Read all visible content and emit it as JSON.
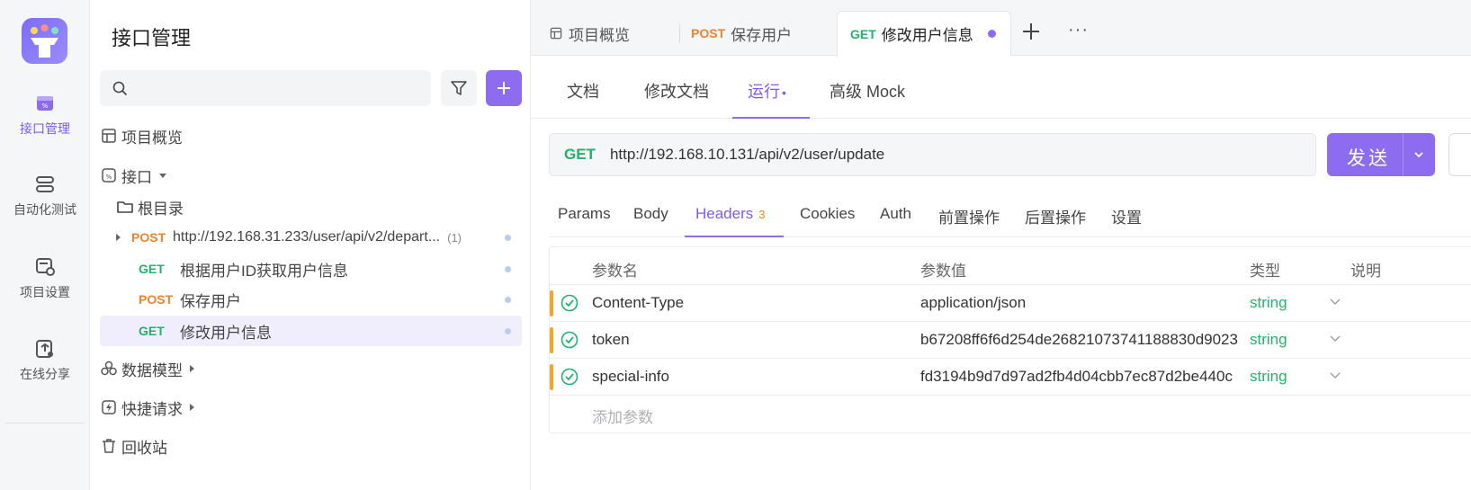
{
  "rail": {
    "items": [
      {
        "label": "接口管理",
        "icon": "api-management-icon",
        "active": true
      },
      {
        "label": "自动化测试",
        "icon": "automation-test-icon",
        "active": false
      },
      {
        "label": "项目设置",
        "icon": "project-settings-icon",
        "active": false
      },
      {
        "label": "在线分享",
        "icon": "online-share-icon",
        "active": false
      }
    ]
  },
  "tree": {
    "title": "接口管理",
    "search_placeholder": "",
    "overview": "项目概览",
    "api_group": "接口",
    "root_dir": "根目录",
    "endpoints": [
      {
        "method": "POST",
        "name": "http://192.168.31.233/user/api/v2/depart...",
        "count": "(1)"
      },
      {
        "method": "GET",
        "name": "根据用户ID获取用户信息"
      },
      {
        "method": "POST",
        "name": "保存用户"
      },
      {
        "method": "GET",
        "name": "修改用户信息"
      }
    ],
    "data_model": "数据模型",
    "quick_request": "快捷请求",
    "recycle_bin": "回收站"
  },
  "tabs": {
    "items": [
      {
        "method": "",
        "label": "项目概览"
      },
      {
        "method": "POST",
        "label": "保存用户"
      },
      {
        "method": "GET",
        "label": "修改用户信息"
      }
    ]
  },
  "subtabs": {
    "items": [
      "文档",
      "修改文档",
      "运行",
      "高级 Mock"
    ],
    "run_dot": "•"
  },
  "request": {
    "method": "GET",
    "url": "http://192.168.10.131/api/v2/user/update",
    "send_label": "发送"
  },
  "param_tabs": {
    "items": [
      "Params",
      "Body",
      "Headers",
      "Cookies",
      "Auth",
      "前置操作",
      "后置操作",
      "设置"
    ],
    "headers_count": "3"
  },
  "headers_table": {
    "columns": [
      "参数名",
      "参数值",
      "类型",
      "说明"
    ],
    "rows": [
      {
        "name": "Content-Type",
        "value": "application/json",
        "type": "string"
      },
      {
        "name": "token",
        "value": "b67208ff6f6d254de26821073741188830d9023",
        "type": "string"
      },
      {
        "name": "special-info",
        "value": "fd3194b9d7d97ad2fb4d04cbb7ec87d2be440c",
        "type": "string"
      }
    ],
    "add_placeholder": "添加参数"
  },
  "colors": {
    "accent": "#8e6cf0",
    "get": "#22b36b",
    "post": "#f0832c",
    "row_marker": "#f5a524"
  }
}
